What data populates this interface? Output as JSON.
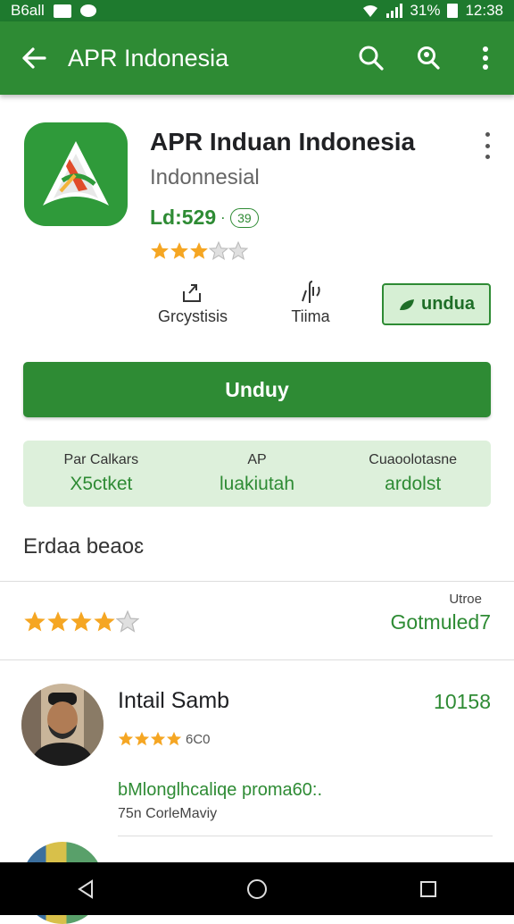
{
  "status_bar": {
    "left_text": "B6all",
    "battery_text": "31%",
    "time": "12:38"
  },
  "app_bar": {
    "title": "APR Indonesia",
    "back_icon": "arrow-left-icon",
    "actions": [
      "search-icon",
      "search-person-icon",
      "more-vert-icon"
    ]
  },
  "app": {
    "name": "APR Induan Indonesia",
    "developer": "Indonnesial",
    "price": "Ld:529",
    "price_dot": "·",
    "price_badge": "39",
    "stars_full": 3,
    "stars_total": 5
  },
  "meta": [
    {
      "icon": "share-icon",
      "label": "Grcystisis"
    },
    {
      "icon": "touch-icon",
      "label": "Tiima"
    }
  ],
  "small_button": {
    "label": "undua",
    "icon": "leaf-icon"
  },
  "primary_button": {
    "label": "Unduy"
  },
  "info": [
    {
      "label": "Par Calkars",
      "value": "X5ctket"
    },
    {
      "label": "AP",
      "value": "luakiutah"
    },
    {
      "label": "Cuaoolotasne",
      "value": "ardolst"
    }
  ],
  "section_title": "Erdaa beaoɛ",
  "rating": {
    "stars_full": 4,
    "stars_total": 5,
    "label": "Utroe",
    "value": "Gotmuled7"
  },
  "review": {
    "name": "Intail Samb",
    "count": "10158",
    "stars_full": 4,
    "star_number": "6C0",
    "title": "bMlonglhcaliqe proma60:.",
    "subtitle": "75n CorleMaviy"
  },
  "colors": {
    "primary": "#2e8b34",
    "status_bar": "#1e7a2e",
    "accent_light": "#ddf0db",
    "star": "#f5a623"
  }
}
